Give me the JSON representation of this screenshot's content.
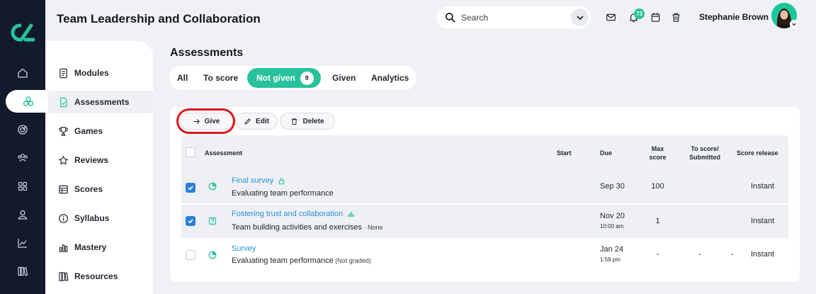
{
  "header": {
    "title": "Team Leadership and Collaboration",
    "search_placeholder": "Search",
    "notifications_count": "73",
    "user_name": "Stephanie Brown"
  },
  "rail": {
    "items": [
      {
        "icon": "home-icon"
      },
      {
        "icon": "modules-icon",
        "active": true
      },
      {
        "icon": "target-icon"
      },
      {
        "icon": "users-icon"
      },
      {
        "icon": "grid-icon"
      },
      {
        "icon": "person-icon"
      },
      {
        "icon": "chart-line-icon"
      },
      {
        "icon": "library-icon"
      }
    ]
  },
  "subnav": {
    "items": [
      {
        "label": "Modules",
        "icon": "document-icon"
      },
      {
        "label": "Assessments",
        "icon": "file-check-icon",
        "active": true
      },
      {
        "label": "Games",
        "icon": "trophy-icon"
      },
      {
        "label": "Reviews",
        "icon": "star-icon"
      },
      {
        "label": "Scores",
        "icon": "table-icon"
      },
      {
        "label": "Syllabus",
        "icon": "info-icon"
      },
      {
        "label": "Mastery",
        "icon": "bar-chart-icon"
      },
      {
        "label": "Resources",
        "icon": "books-icon"
      }
    ]
  },
  "page": {
    "title": "Assessments",
    "tabs": [
      {
        "label": "All"
      },
      {
        "label": "To score"
      },
      {
        "label": "Not given",
        "count": "9",
        "active": true
      },
      {
        "label": "Given"
      },
      {
        "label": "Analytics"
      }
    ]
  },
  "toolbar": {
    "give_label": "Give",
    "edit_label": "Edit",
    "delete_label": "Delete"
  },
  "table": {
    "headers": {
      "assessment": "Assessment",
      "start": "Start",
      "due": "Due",
      "max_score": "Max score",
      "to_score": "To score/ Submitted",
      "release": "Score release"
    },
    "rows": [
      {
        "checked": true,
        "type_icon": "pie-chart-icon",
        "name": "Final survey",
        "name_icon": "lock-icon",
        "description": "Evaluating team performance",
        "description_suffix": "",
        "start": "",
        "due_date": "Sep 30",
        "due_time": "",
        "max_score": "100",
        "to_score": "",
        "submitted": "",
        "release": "Instant"
      },
      {
        "checked": true,
        "type_icon": "question-icon",
        "name": "Fostering trust and collaboration",
        "name_icon": "bar-chart-icon",
        "description": "Team building activities and exercises",
        "description_suffix": " · None",
        "start": "",
        "due_date": "Nov 20",
        "due_time": "10:00 am",
        "max_score": "1",
        "to_score": "",
        "submitted": "",
        "release": "Instant"
      },
      {
        "checked": false,
        "type_icon": "pie-chart-icon",
        "name": "Survey",
        "name_icon": "",
        "description": "Evaluating team performance",
        "description_suffix": " (Not graded)",
        "start": "",
        "due_date": "Jan 24",
        "due_time": "1:59 pm",
        "max_score": "-",
        "to_score": "-",
        "submitted": "-",
        "release": "Instant"
      }
    ]
  },
  "colors": {
    "accent": "#27c29c",
    "link": "#2a90d6",
    "rail": "#121a2b",
    "checkbox": "#2b7fd9",
    "highlight": "#e3141b"
  }
}
